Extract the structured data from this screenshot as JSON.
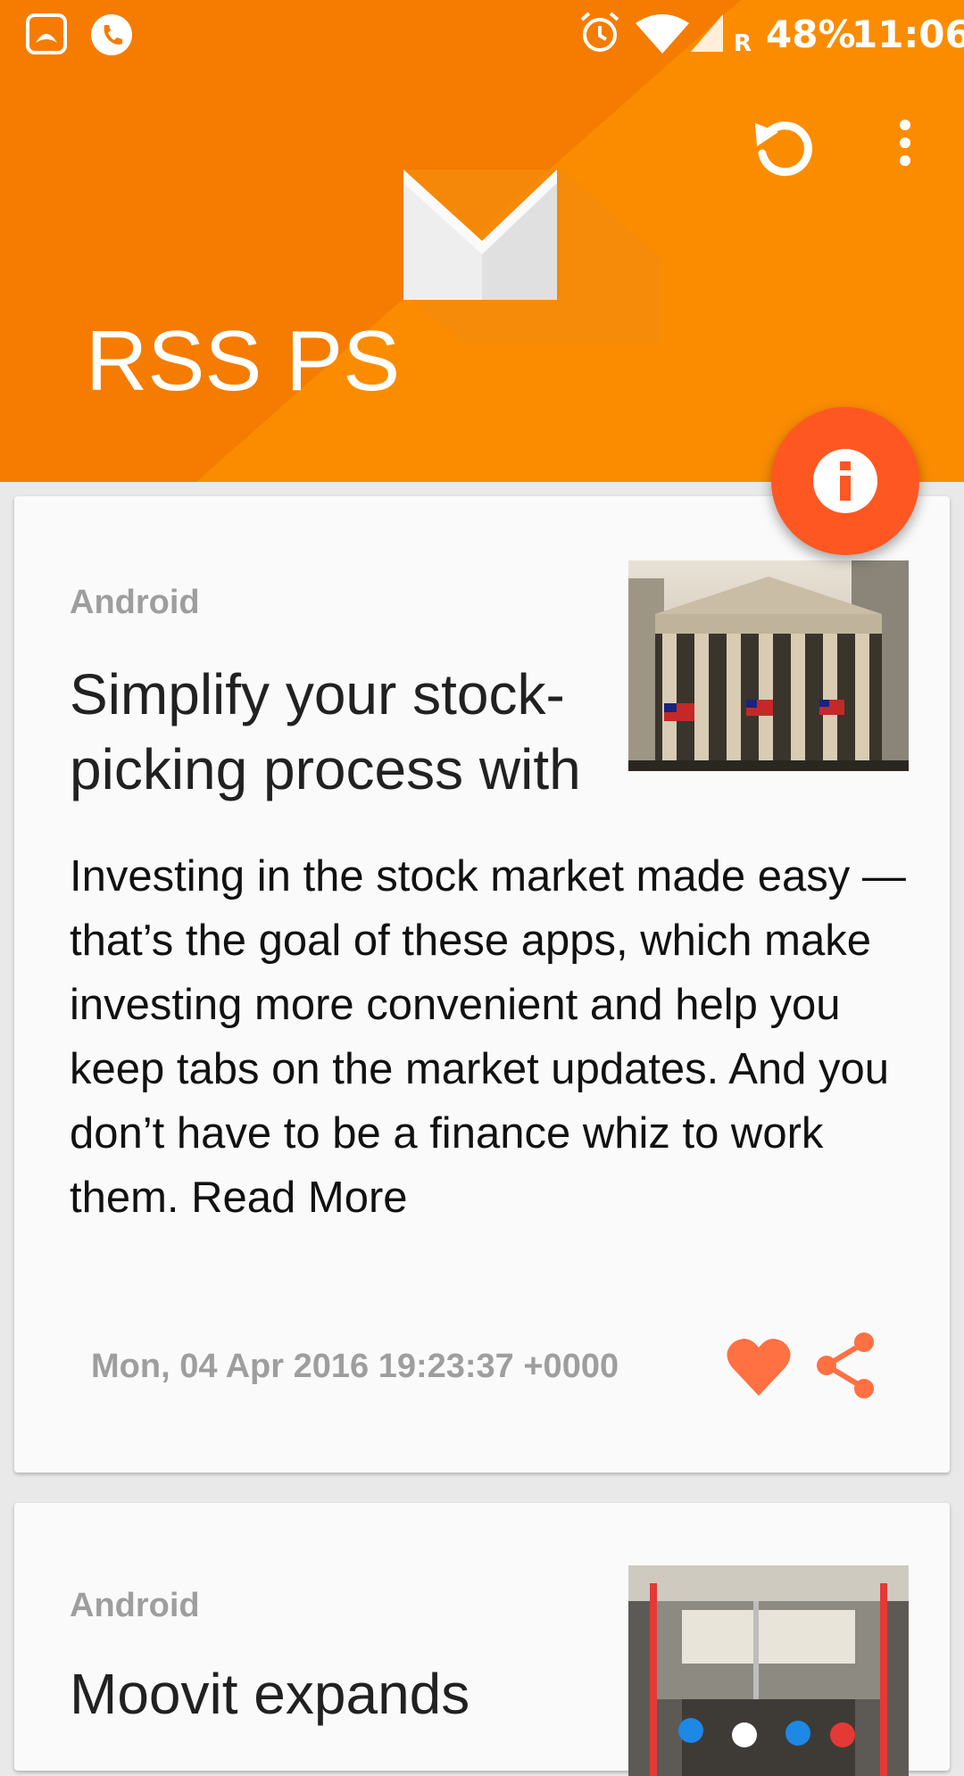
{
  "status_bar": {
    "battery": "48%",
    "time": "11:06",
    "network": "R",
    "icons": [
      "saavn-icon",
      "phone-icon",
      "alarm-icon",
      "wifi-icon",
      "signal-icon"
    ]
  },
  "app": {
    "title": "RSS PS",
    "actions": [
      "refresh-icon",
      "more-vert-icon"
    ],
    "fab_icon": "info-icon",
    "colors": {
      "primary": "#f57f17",
      "accent": "#ff5722"
    }
  },
  "articles": [
    {
      "category": "Android",
      "title": "Simplify your stock-picking process with",
      "description": "Investing in the stock market made easy — that’s the goal of these apps, which make investing more convenient and help you keep tabs on the market updates. And you don’t have to be a finance whiz to work them. Read More",
      "date": "Mon, 04 Apr 2016 19:23:37 +0000",
      "actions": [
        "favorite-icon",
        "share-icon"
      ]
    },
    {
      "category": "Android",
      "title": "Moovit expands"
    }
  ]
}
